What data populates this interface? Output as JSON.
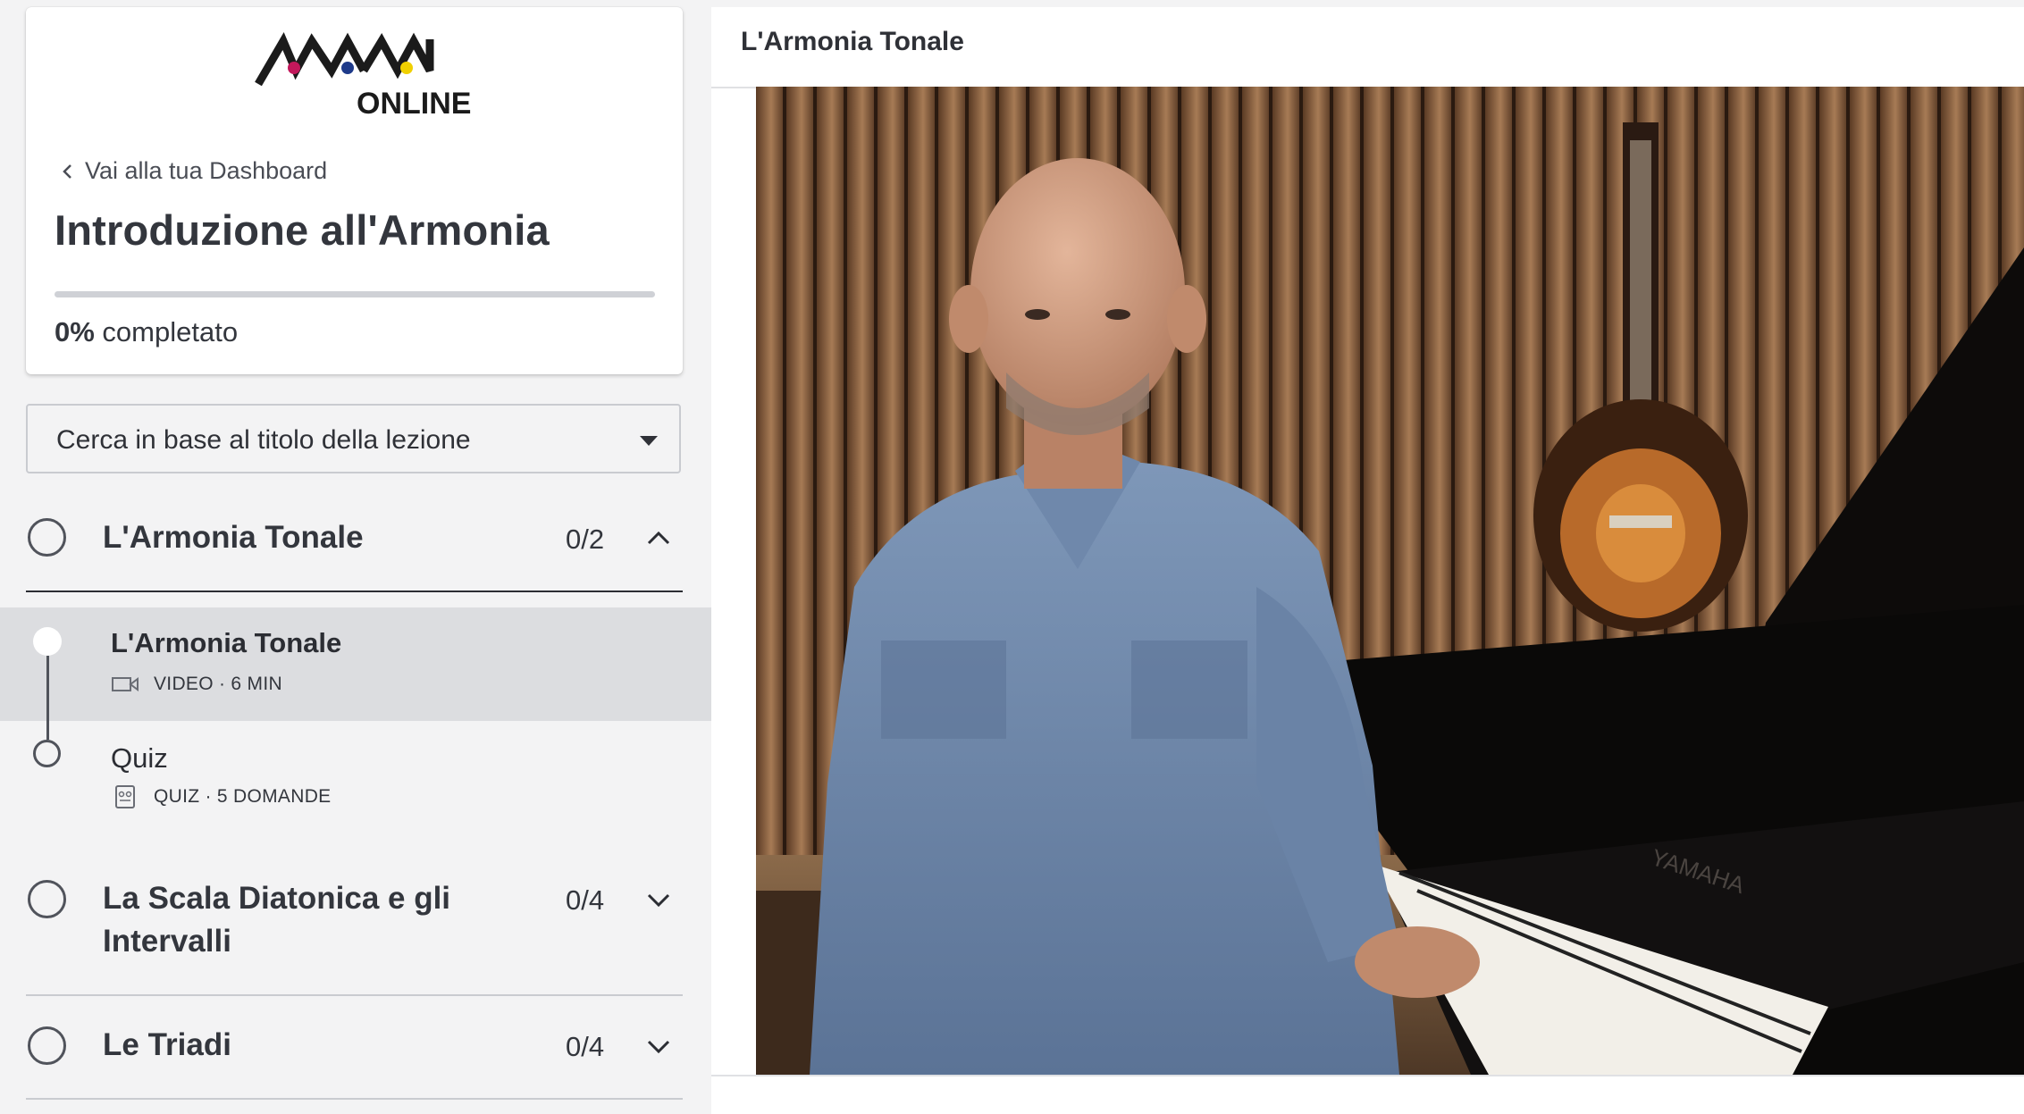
{
  "sidebar": {
    "logo": {
      "top": "NAM",
      "bottom": "ONLINE",
      "dot_colors": [
        "#c2185b",
        "#1e3a8a",
        "#f0d000"
      ]
    },
    "back_link": "Vai alla tua Dashboard",
    "course_title": "Introduzione all'Armonia",
    "progress": {
      "percent": 0,
      "percent_label": "0%",
      "suffix": " completato"
    },
    "search_placeholder": "Cerca in base al titolo della lezione",
    "sections": [
      {
        "title": "L'Armonia Tonale",
        "count": "0/2",
        "expanded": true,
        "lessons": [
          {
            "title": "L'Armonia Tonale",
            "meta": "VIDEO · 6 MIN",
            "icon": "video-icon",
            "active": true
          },
          {
            "title": "Quiz",
            "meta": "QUIZ · 5 DOMANDE",
            "icon": "quiz-icon",
            "active": false
          }
        ]
      },
      {
        "title_line1": "La Scala Diatonica e gli",
        "title_line2": "Intervalli",
        "count": "0/4",
        "expanded": false
      },
      {
        "title": "Le Triadi",
        "count": "0/4",
        "expanded": false
      }
    ]
  },
  "main": {
    "lesson_title": "L'Armonia Tonale",
    "video_brand_text": "YAMAHA"
  },
  "colors": {
    "accent": "#3b5bdb",
    "active_row": "#dcdde0",
    "sidebar_bg": "#f3f3f4"
  }
}
